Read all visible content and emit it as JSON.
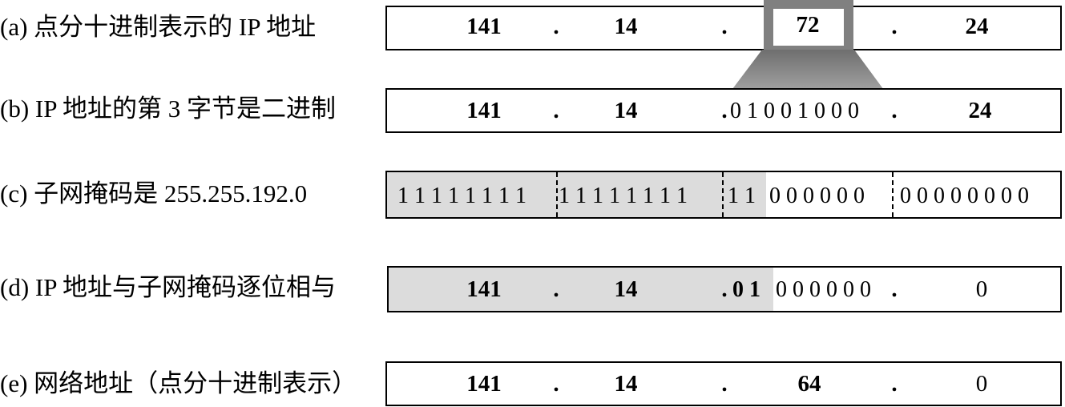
{
  "rows": {
    "a": {
      "label": "(a) 点分十进制表示的 IP 地址",
      "o1": "141",
      "d1": ".",
      "o2": "14",
      "d2": ".",
      "o3": "72",
      "d3": ".",
      "o4": "24"
    },
    "b": {
      "label": "(b) IP 地址的第 3 字节是二进制",
      "o1": "141",
      "d1": ".",
      "o2": "14",
      "d2": ".",
      "o3": "0 1 0 0 1 0 0 0",
      "d3": ".",
      "o4": "24"
    },
    "c": {
      "label": "(c) 子网掩码是 255.255.192.0",
      "b1": "1 1 1 1 1 1 1 1",
      "b2": "1 1 1 1 1 1 1 1",
      "b3a": "1 1",
      "b3b": "0 0 0 0 0 0",
      "b4": "0 0 0 0 0 0 0 0"
    },
    "d": {
      "label": "(d) IP 地址与子网掩码逐位相与",
      "o1": "141",
      "d1": ".",
      "o2": "14",
      "d2": ".",
      "o3a": "0 1",
      "o3b": "0 0 0 0 0 0",
      "d3": ".",
      "o4": "0"
    },
    "e": {
      "label": "(e) 网络地址（点分十进制表示）",
      "o1": "141",
      "d1": ".",
      "o2": "14",
      "d2": ".",
      "o3": "64",
      "d3": ".",
      "o4": "0"
    }
  },
  "colors": {
    "shade": "#dcdcdc",
    "highlight_frame": "#808080"
  }
}
